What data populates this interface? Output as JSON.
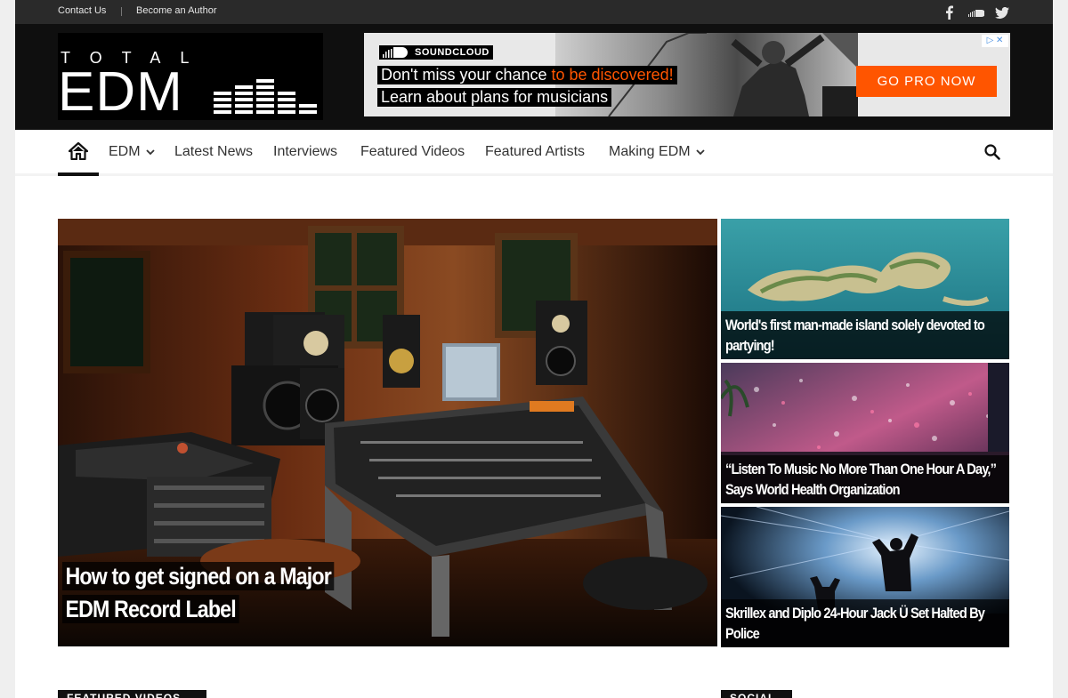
{
  "topbar": {
    "links": [
      "Contact Us",
      "Become an Author"
    ],
    "social": [
      "facebook-icon",
      "soundcloud-icon",
      "twitter-icon"
    ]
  },
  "logo": {
    "top_text": "TOTAL",
    "main_text": "EDM"
  },
  "ad": {
    "brand": "SOUNDCLOUD",
    "line1_a": "Don't miss your chance ",
    "line1_b": "to be discovered!",
    "line2": "Learn about plans for musicians",
    "cta": "GO PRO NOW",
    "adchoice": "▷ ✕",
    "accent": "#ff5500"
  },
  "nav": {
    "items": [
      {
        "label": "EDM",
        "dropdown": true
      },
      {
        "label": "Latest News",
        "dropdown": false
      },
      {
        "label": "Interviews",
        "dropdown": false
      },
      {
        "label": "Featured Videos",
        "dropdown": false
      },
      {
        "label": "Featured Artists",
        "dropdown": false
      },
      {
        "label": "Making EDM",
        "dropdown": true
      }
    ]
  },
  "featured": {
    "main": {
      "line1": "How to get signed on a Major",
      "line2": "EDM Record Label"
    },
    "side": [
      {
        "line1": "World's first man-made island solely devoted to",
        "line2": "partying!"
      },
      {
        "line1": "“Listen To Music No More Than One Hour A Day,”",
        "line2": "Says World Health Organization"
      },
      {
        "line1": "Skrillex and Diplo 24-Hour Jack Ü Set Halted By",
        "line2": "Police"
      }
    ]
  },
  "sections": {
    "left": "FEATURED VIDEOS",
    "right": "SOCIAL"
  }
}
